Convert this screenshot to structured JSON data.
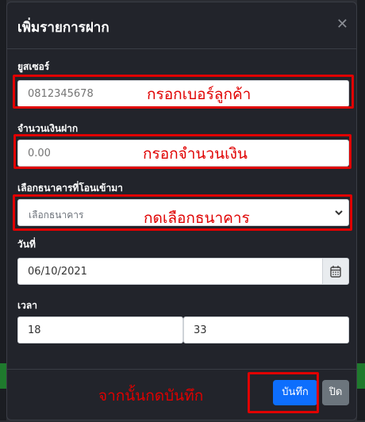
{
  "modal": {
    "title": "เพิ่มรายการฝาก",
    "close_symbol": "✕"
  },
  "fields": {
    "user": {
      "label": "ยูสเซอร์",
      "placeholder": "0812345678",
      "annotation": "กรอกเบอร์ลูกค้า"
    },
    "amount": {
      "label": "จำนวนเงินฝาก",
      "placeholder": "0.00",
      "annotation": "กรอกจำนวนเงิน"
    },
    "bank": {
      "label": "เลือกธนาคารที่โอนเข้ามา",
      "selected": "เลือกธนาคาร",
      "annotation": "กดเลือกธนาคาร"
    },
    "date": {
      "label": "วันที่",
      "value": "06/10/2021"
    },
    "time": {
      "label": "เวลา",
      "hour": "18",
      "minute": "33"
    }
  },
  "footer": {
    "annotation": "จากนั้นกดบันทึก",
    "save_label": "บันทึก",
    "close_label": "ปิด"
  },
  "colors": {
    "annotation": "#e00000",
    "primary": "#0d6efd",
    "secondary": "#6c757d",
    "modal_bg": "#22242b"
  }
}
